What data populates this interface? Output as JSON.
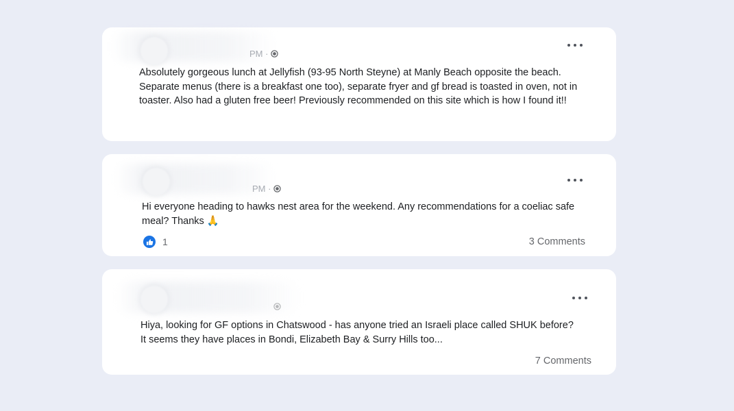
{
  "posts": [
    {
      "timestamp_suffix": "PM ·",
      "text": "Absolutely gorgeous lunch at Jellyfish (93-95 North Steyne) at Manly Beach opposite the beach. Separate menus (there is a breakfast one too), separate fryer and gf bread is toasted in oven, not in toaster. Also had a gluten free beer!  Previously recommended on this site which is how I found it!!",
      "more_icon": "more-options-icon",
      "privacy_icon": "globe-icon"
    },
    {
      "timestamp_suffix": "PM ·",
      "text": "Hi everyone heading to hawks nest area for the weekend. Any recommendations for a coeliac safe meal? Thanks 🙏",
      "like_count": "1",
      "comments": "3 Comments",
      "more_icon": "more-options-icon",
      "privacy_icon": "globe-icon",
      "reaction_icon": "thumbs-up-icon"
    },
    {
      "text": "Hiya, looking for GF options in Chatswood - has anyone tried an Israeli place called SHUK before? It seems they have places in Bondi, Elizabeth Bay & Surry Hills too...",
      "comments": "7 Comments",
      "more_icon": "more-options-icon",
      "privacy_icon": "globe-icon"
    }
  ],
  "colors": {
    "background": "#eaedf6",
    "card": "#ffffff",
    "like_blue": "#1b74e4",
    "secondary_text": "#65676b"
  }
}
